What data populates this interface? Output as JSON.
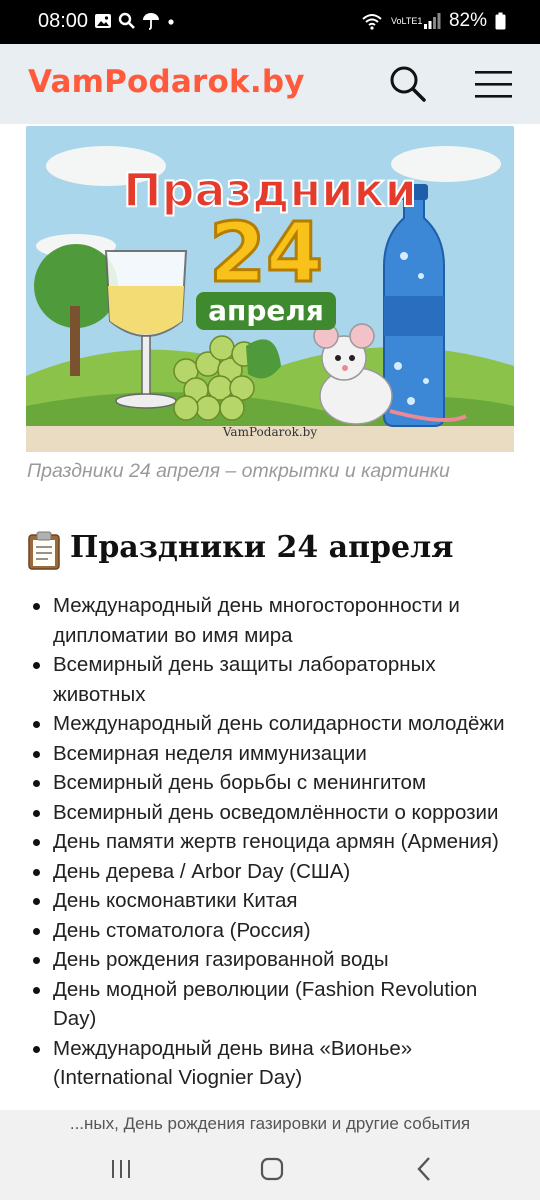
{
  "status_bar": {
    "time": "08:00",
    "network": "VoLTE1",
    "battery": "82%"
  },
  "header": {
    "logo": "VamPodarok.by"
  },
  "hero_image": {
    "title_line1": "Праздники",
    "title_number": "24",
    "title_line2": "апреля",
    "watermark": "VamPodarok.by",
    "caption": "Праздники 24 апреля – открытки и картинки"
  },
  "section": {
    "title": "Праздники 24 апреля",
    "icon": "clipboard-icon"
  },
  "holidays": [
    "Международный день многосторонности и дипломатии во имя мира",
    "Всемирный день защиты лабораторных животных",
    "Международный день солидарности молодёжи",
    "Всемирная неделя иммунизации",
    "Всемирный день борьбы с менингитом",
    "Всемирный день осведомлённости о коррозии",
    "День памяти жертв геноцида армян (Армения)",
    "День дерева / Arbor Day (США)",
    "День космонавтики Китая",
    "День стоматолога (Россия)",
    "День рождения газированной воды",
    "День модной революции (Fashion Revolution Day)",
    "Международный день вина «Вионье» (International Viognier Day)"
  ],
  "bottom_bar": {
    "text": "...ных, День рождения газировки и другие события"
  },
  "colors": {
    "logo": "#ff5a3c",
    "header_bg": "#e9eef2"
  }
}
